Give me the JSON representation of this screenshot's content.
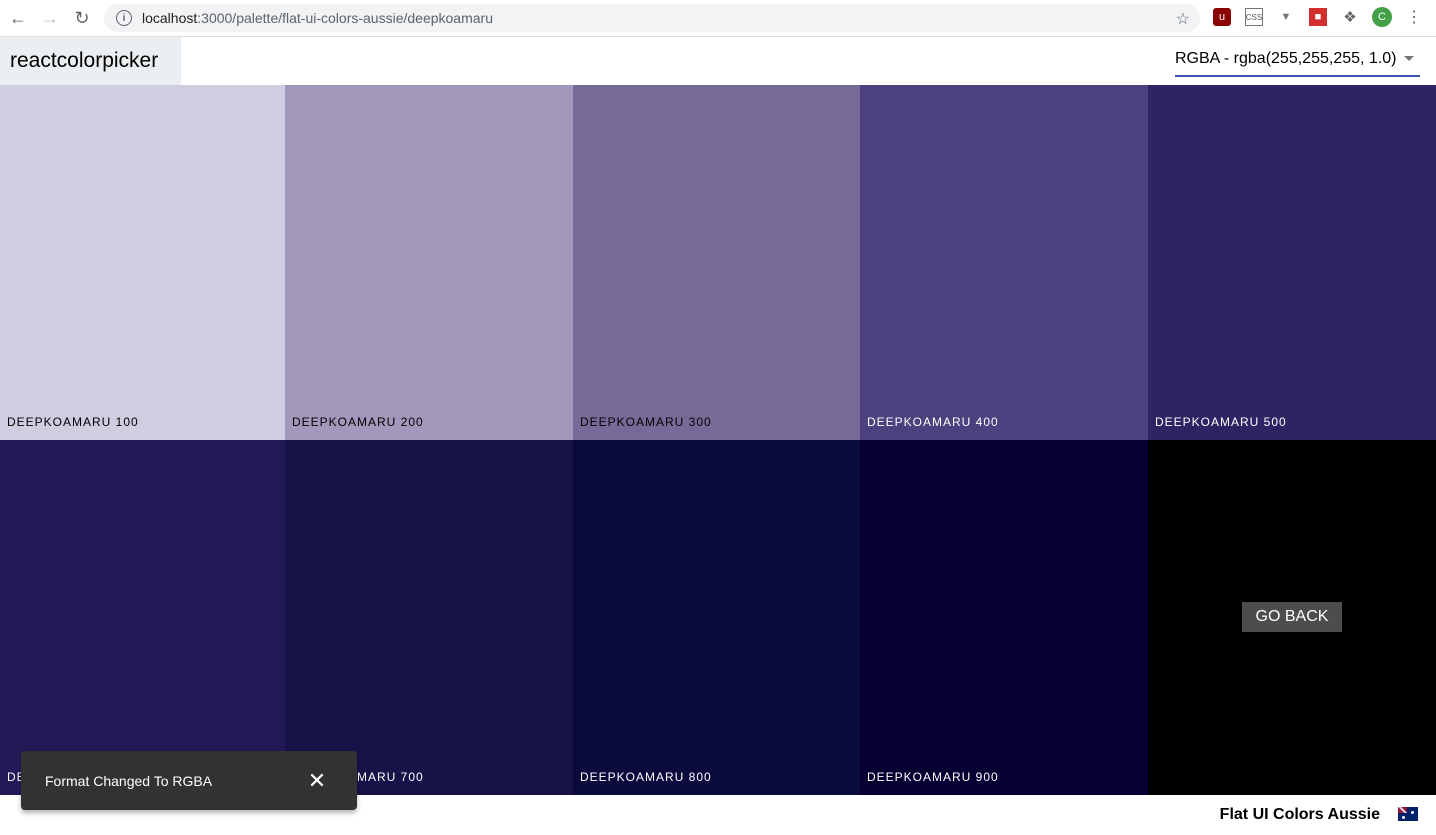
{
  "browser": {
    "url_host": "localhost",
    "url_rest": ":3000/palette/flat-ui-colors-aussie/deepkoamaru"
  },
  "app": {
    "logo": "reactcolorpicker",
    "format_select_value": "RGBA - rgba(255,255,255, 1.0)"
  },
  "palette": {
    "boxes": [
      {
        "label": "DEEPKOAMARU 100",
        "color": "#d1cde0",
        "text_color": "#000000"
      },
      {
        "label": "DEEPKOAMARU 200",
        "color": "#a298bb",
        "text_color": "#000000"
      },
      {
        "label": "DEEPKOAMARU 300",
        "color": "#766b98",
        "text_color": "#000000"
      },
      {
        "label": "DEEPKOAMARU 400",
        "color": "#4c417e",
        "text_color": "#ffffff"
      },
      {
        "label": "DEEPKOAMARU 500",
        "color": "#2f2463",
        "text_color": "#ffffff"
      },
      {
        "label": "DEEPKOAMARU 600",
        "color": "#221a56",
        "text_color": "#ffffff"
      },
      {
        "label": "DEEPKOAMARU 700",
        "color": "#171349",
        "text_color": "#ffffff"
      },
      {
        "label": "DEEPKOAMARU 800",
        "color": "#0a0a3d",
        "text_color": "#ffffff"
      },
      {
        "label": "DEEPKOAMARU 900",
        "color": "#050031",
        "text_color": "#ffffff"
      }
    ],
    "go_back_label": "GO BACK",
    "go_back_bg": "#000000"
  },
  "footer": {
    "palette_name": "Flat UI Colors Aussie",
    "emoji_icon": "australia-flag-icon"
  },
  "snackbar": {
    "message": "Format Changed To RGBA"
  }
}
